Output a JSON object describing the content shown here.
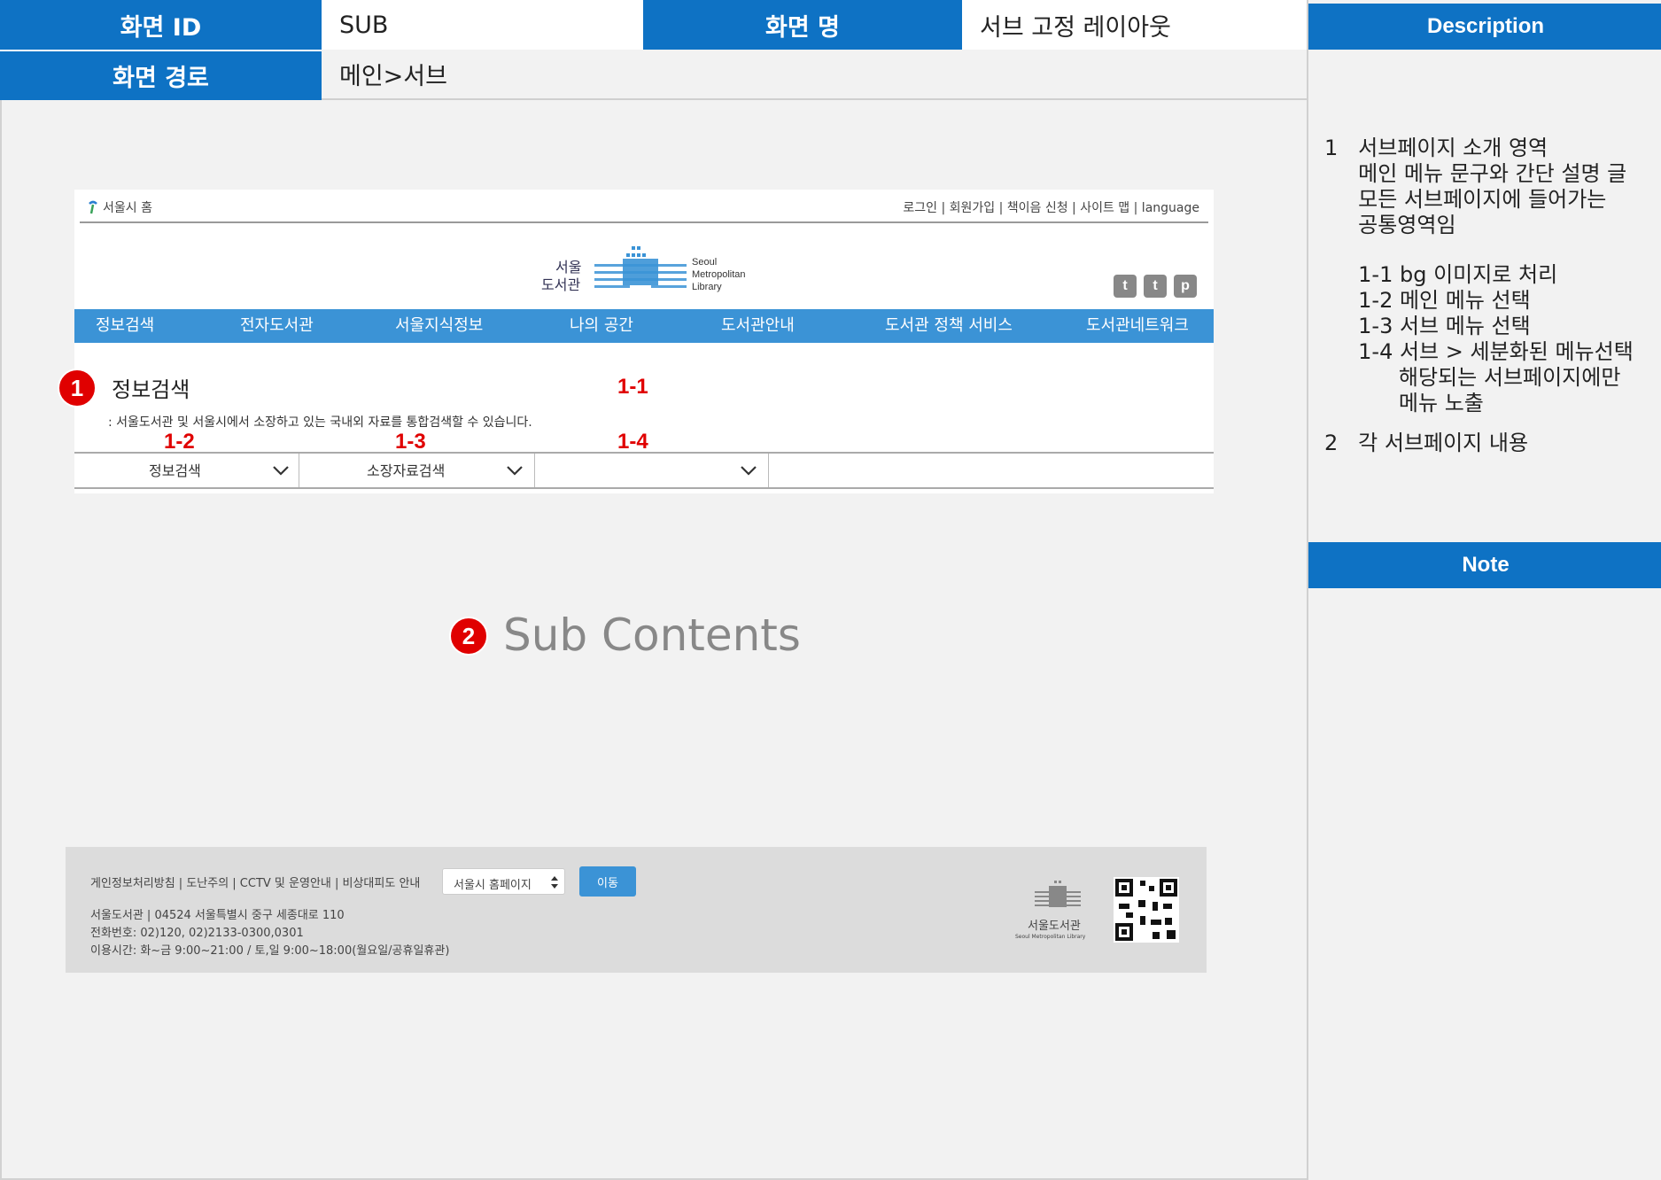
{
  "spec": {
    "screen_id_label": "화면 ID",
    "screen_id_value": "SUB",
    "screen_name_label": "화면 명",
    "screen_name_value": "서브 고정 레이아웃",
    "path_label": "화면 경로",
    "path_value": "메인>서브"
  },
  "sidebar": {
    "description_title": "Description",
    "lines": [
      "1   서브페이지 소개 영역",
      "     메인 메뉴 문구와 간단 설명 글",
      "     모든 서브페이지에 들어가는",
      "     공통영역임",
      "",
      "     1-1 bg 이미지로 처리",
      "     1-2 메인 메뉴 선택",
      "     1-3 서브 메뉴 선택",
      "     1-4 서브 > 세분화된 메뉴선택",
      "           해당되는 서브페이지에만",
      "           메뉴 노출"
    ],
    "line2": "2   각 서브페이지 내용",
    "note_title": "Note"
  },
  "site": {
    "home_link": "서울시 홈",
    "top_links": "로그인 | 회원가입 | 책이음 신청 | 사이트 맵 | language",
    "logo_ko_1": "서울",
    "logo_ko_2": "도서관",
    "logo_en_1": "Seoul",
    "logo_en_2": "Metropolitan",
    "logo_en_3": "Library",
    "social": [
      "t",
      "t",
      "p"
    ],
    "gnb": [
      "정보검색",
      "전자도서관",
      "서울지식정보",
      "나의 공간",
      "도서관안내",
      "도서관 정책 서비스",
      "도서관네트워크"
    ],
    "page_title": "정보검색",
    "page_desc": ": 서울도서관 및 서울시에서 소장하고 있는 국내외 자료를 통합검색할 수 있습니다.",
    "snb": [
      "정보검색",
      "소장자료검색",
      ""
    ],
    "markers": {
      "m1": "1",
      "m2": "2"
    },
    "labels": {
      "l11": "1-1",
      "l12": "1-2",
      "l13": "1-3",
      "l14": "1-4"
    },
    "sub_contents": "Sub Contents"
  },
  "footer": {
    "links": "게인정보처리방침 | 도난주의 | CCTV 및 운영안내 | 비상대피도 안내",
    "select_value": "서울시 홈페이지",
    "go_button": "이동",
    "address": "서울도서관 | 04524 서울특별시 중구 세종대로 110",
    "phone": "전화번호: 02)120, 02)2133-0300,0301",
    "hours": "이용시간: 화~금 9:00~21:00 / 토,일 9:00~18:00(월요일/공휴일휴관)",
    "logo_ko": "서울도서관",
    "logo_en": "Seoul Metropolitan Library"
  },
  "colors": {
    "header_blue": "#0e72c4",
    "gnb_blue": "#3b93d6",
    "marker_red": "#e00000"
  }
}
